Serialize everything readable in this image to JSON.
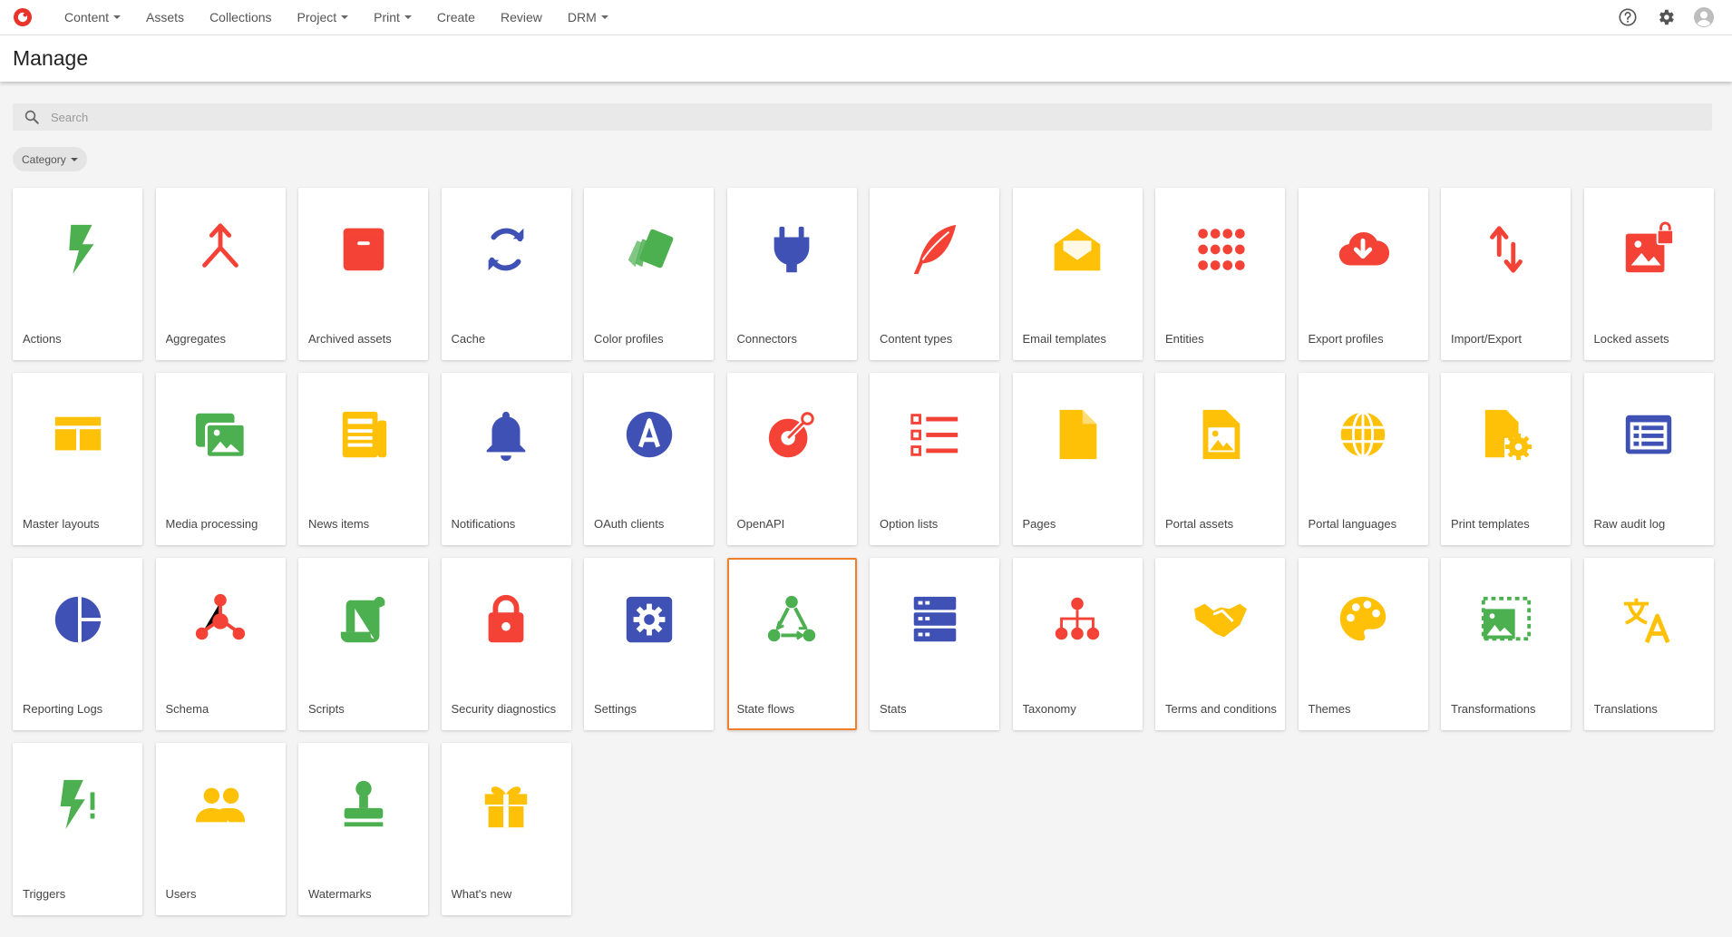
{
  "topnav": {
    "items": [
      {
        "label": "Content",
        "dropdown": true
      },
      {
        "label": "Assets",
        "dropdown": false
      },
      {
        "label": "Collections",
        "dropdown": false
      },
      {
        "label": "Project",
        "dropdown": true
      },
      {
        "label": "Print",
        "dropdown": true
      },
      {
        "label": "Create",
        "dropdown": false
      },
      {
        "label": "Review",
        "dropdown": false
      },
      {
        "label": "DRM",
        "dropdown": true
      }
    ],
    "right_icons": [
      "help-icon",
      "settings-icon",
      "user-avatar-icon"
    ],
    "brand_color": "#e8342b"
  },
  "header": {
    "title": "Manage"
  },
  "search": {
    "placeholder": "Search",
    "value": ""
  },
  "filters": {
    "category_label": "Category"
  },
  "selected_tile": "State flows",
  "selection_color": "#f07f2a",
  "tiles": [
    {
      "label": "Actions",
      "icon": "lightning-icon",
      "color": "#4caf50"
    },
    {
      "label": "Aggregates",
      "icon": "merge-icon",
      "color": "#f44336"
    },
    {
      "label": "Archived assets",
      "icon": "archive-box-icon",
      "color": "#f44336"
    },
    {
      "label": "Cache",
      "icon": "sync-icon",
      "color": "#3f51b5"
    },
    {
      "label": "Color profiles",
      "icon": "color-swatches-icon",
      "color": "#4caf50"
    },
    {
      "label": "Connectors",
      "icon": "plug-icon",
      "color": "#3f51b5"
    },
    {
      "label": "Content types",
      "icon": "feather-icon",
      "color": "#f44336"
    },
    {
      "label": "Email templates",
      "icon": "open-envelope-icon",
      "color": "#ffc107"
    },
    {
      "label": "Entities",
      "icon": "dots-grid-icon",
      "color": "#f44336"
    },
    {
      "label": "Export profiles",
      "icon": "cloud-download-icon",
      "color": "#f44336"
    },
    {
      "label": "Import/Export",
      "icon": "swap-vertical-icon",
      "color": "#f44336"
    },
    {
      "label": "Locked assets",
      "icon": "image-lock-icon",
      "color": "#f44336"
    },
    {
      "label": "Master layouts",
      "icon": "layout-icon",
      "color": "#ffc107"
    },
    {
      "label": "Media processing",
      "icon": "media-images-icon",
      "color": "#4caf50"
    },
    {
      "label": "News items",
      "icon": "newspaper-icon",
      "color": "#ffc107"
    },
    {
      "label": "Notifications",
      "icon": "bell-icon",
      "color": "#3f51b5"
    },
    {
      "label": "OAuth clients",
      "icon": "oauth-a-icon",
      "color": "#3f51b5"
    },
    {
      "label": "OpenAPI",
      "icon": "openapi-icon",
      "color": "#f44336"
    },
    {
      "label": "Option lists",
      "icon": "checklist-icon",
      "color": "#f44336"
    },
    {
      "label": "Pages",
      "icon": "page-icon",
      "color": "#ffc107"
    },
    {
      "label": "Portal assets",
      "icon": "image-file-icon",
      "color": "#ffc107"
    },
    {
      "label": "Portal languages",
      "icon": "globe-icon",
      "color": "#ffc107"
    },
    {
      "label": "Print templates",
      "icon": "file-cog-icon",
      "color": "#ffc107"
    },
    {
      "label": "Raw audit log",
      "icon": "list-card-icon",
      "color": "#3f51b5"
    },
    {
      "label": "Reporting Logs",
      "icon": "pie-chart-icon",
      "color": "#3f51b5"
    },
    {
      "label": "Schema",
      "icon": "graph-nodes-icon",
      "color": "#f44336"
    },
    {
      "label": "Scripts",
      "icon": "script-scroll-icon",
      "color": "#4caf50"
    },
    {
      "label": "Security diagnostics",
      "icon": "padlock-icon",
      "color": "#f44336"
    },
    {
      "label": "Settings",
      "icon": "cog-box-icon",
      "color": "#3f51b5"
    },
    {
      "label": "State flows",
      "icon": "state-cycle-icon",
      "color": "#4caf50"
    },
    {
      "label": "Stats",
      "icon": "server-icon",
      "color": "#3f51b5"
    },
    {
      "label": "Taxonomy",
      "icon": "hierarchy-icon",
      "color": "#f44336"
    },
    {
      "label": "Terms and conditions",
      "icon": "handshake-icon",
      "color": "#ffc107"
    },
    {
      "label": "Themes",
      "icon": "palette-icon",
      "color": "#ffc107"
    },
    {
      "label": "Transformations",
      "icon": "image-transform-icon",
      "color": "#4caf50"
    },
    {
      "label": "Translations",
      "icon": "translate-icon",
      "color": "#ffc107"
    },
    {
      "label": "Triggers",
      "icon": "lightning-alert-icon",
      "color": "#4caf50"
    },
    {
      "label": "Users",
      "icon": "users-icon",
      "color": "#ffc107"
    },
    {
      "label": "Watermarks",
      "icon": "stamp-icon",
      "color": "#4caf50"
    },
    {
      "label": "What's new",
      "icon": "gift-icon",
      "color": "#ffc107"
    }
  ]
}
